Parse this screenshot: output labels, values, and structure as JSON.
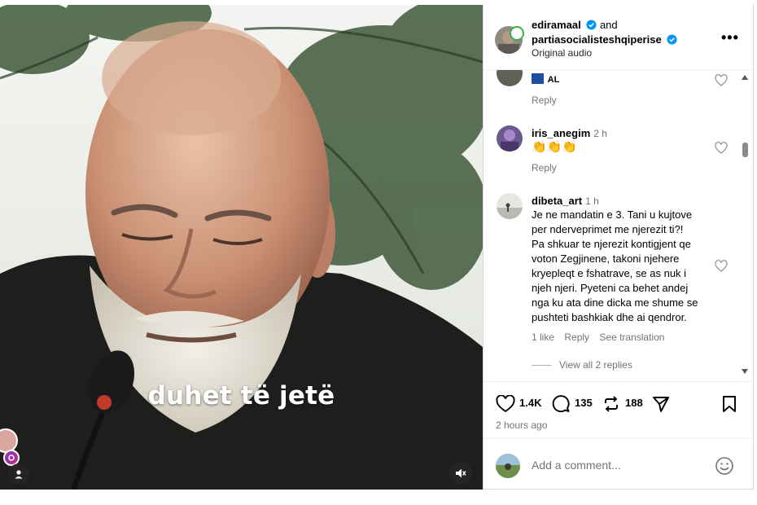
{
  "header": {
    "user1": "ediramaal",
    "and": "and",
    "user2": "partiasocialisteshqiperise",
    "audio": "Original audio"
  },
  "video": {
    "caption": "duhet të jetë"
  },
  "comments": [
    {
      "partial_text": "AL",
      "reply": "Reply"
    },
    {
      "username": "iris_anegim",
      "time": "2 h",
      "text": "👏👏👏",
      "reply": "Reply"
    },
    {
      "username": "dibeta_art",
      "time": "1 h",
      "lines": [
        "Je ne mandatin e 3. Tani u kujtove",
        "per nderveprimet me njerezit ti?!",
        "Pa shkuar te njerezit kontigjent qe",
        "voton Zegjinene, takoni njehere",
        "kryepleqt e fshatrave, se as nuk i",
        "njeh njeri. Pyeteni ca behet andej",
        "nga ku ata dine dicka me shume se",
        "pushteti bashkiak dhe ai qendror."
      ],
      "likes": "1 like",
      "reply": "Reply",
      "translate": "See translation",
      "view_replies": "View all 2 replies"
    }
  ],
  "actions": {
    "likes": "1.4K",
    "comments": "135",
    "reposts": "188",
    "time_ago": "2 hours ago"
  },
  "add_comment": {
    "placeholder": "Add a comment..."
  },
  "colors": {
    "verified": "#0095f6",
    "meta_text": "#737373",
    "border": "#dbdbdb"
  },
  "icons": [
    "verified-icon",
    "more-icon",
    "heart-icon",
    "comment-icon",
    "repost-icon",
    "share-icon",
    "bookmark-icon",
    "emoji-icon",
    "mute-icon",
    "user-icon"
  ]
}
